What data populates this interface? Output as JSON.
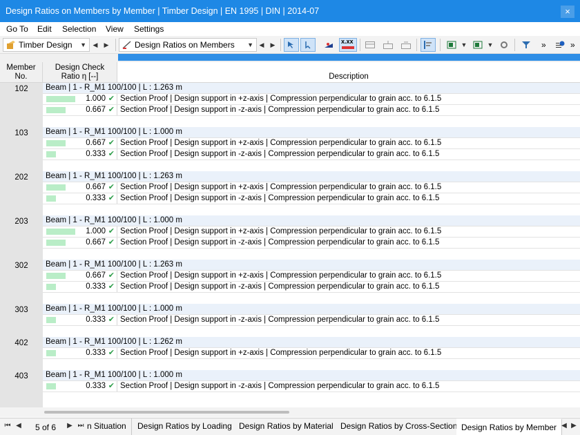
{
  "window": {
    "title": "Design Ratios on Members by Member | Timber Design | EN 1995 | DIN | 2014-07",
    "close_glyph": "×"
  },
  "menu": [
    "Go To",
    "Edit",
    "Selection",
    "View",
    "Settings"
  ],
  "toolbar": {
    "module": "Timber Design",
    "view": "Design Ratios on Members",
    "xxx_label": "x.xx",
    "overflow": "»"
  },
  "columns": {
    "member": [
      "Member",
      "No."
    ],
    "ratio": [
      "Design Check",
      "Ratio η [--]"
    ],
    "description": "Description"
  },
  "members": [
    {
      "no": "102",
      "beam": "Beam | 1 - R_M1 100/100 | L : 1.263 m",
      "checks": [
        {
          "ratio": 1.0,
          "ratio_text": "1.000",
          "desc": "Section Proof | Design support in +z-axis | Compression perpendicular to grain acc. to 6.1.5"
        },
        {
          "ratio": 0.667,
          "ratio_text": "0.667",
          "desc": "Section Proof | Design support in -z-axis | Compression perpendicular to grain acc. to 6.1.5"
        }
      ]
    },
    {
      "no": "103",
      "beam": "Beam | 1 - R_M1 100/100 | L : 1.000 m",
      "checks": [
        {
          "ratio": 0.667,
          "ratio_text": "0.667",
          "desc": "Section Proof | Design support in +z-axis | Compression perpendicular to grain acc. to 6.1.5"
        },
        {
          "ratio": 0.333,
          "ratio_text": "0.333",
          "desc": "Section Proof | Design support in -z-axis | Compression perpendicular to grain acc. to 6.1.5"
        }
      ]
    },
    {
      "no": "202",
      "beam": "Beam | 1 - R_M1 100/100 | L : 1.263 m",
      "checks": [
        {
          "ratio": 0.667,
          "ratio_text": "0.667",
          "desc": "Section Proof | Design support in +z-axis | Compression perpendicular to grain acc. to 6.1.5"
        },
        {
          "ratio": 0.333,
          "ratio_text": "0.333",
          "desc": "Section Proof | Design support in -z-axis | Compression perpendicular to grain acc. to 6.1.5"
        }
      ]
    },
    {
      "no": "203",
      "beam": "Beam | 1 - R_M1 100/100 | L : 1.000 m",
      "checks": [
        {
          "ratio": 1.0,
          "ratio_text": "1.000",
          "desc": "Section Proof | Design support in +z-axis | Compression perpendicular to grain acc. to 6.1.5"
        },
        {
          "ratio": 0.667,
          "ratio_text": "0.667",
          "desc": "Section Proof | Design support in -z-axis | Compression perpendicular to grain acc. to 6.1.5"
        }
      ]
    },
    {
      "no": "302",
      "beam": "Beam | 1 - R_M1 100/100 | L : 1.263 m",
      "checks": [
        {
          "ratio": 0.667,
          "ratio_text": "0.667",
          "desc": "Section Proof | Design support in +z-axis | Compression perpendicular to grain acc. to 6.1.5"
        },
        {
          "ratio": 0.333,
          "ratio_text": "0.333",
          "desc": "Section Proof | Design support in -z-axis | Compression perpendicular to grain acc. to 6.1.5"
        }
      ]
    },
    {
      "no": "303",
      "beam": "Beam | 1 - R_M1 100/100 | L : 1.000 m",
      "checks": [
        {
          "ratio": 0.333,
          "ratio_text": "0.333",
          "desc": "Section Proof | Design support in -z-axis | Compression perpendicular to grain acc. to 6.1.5"
        }
      ]
    },
    {
      "no": "402",
      "beam": "Beam | 1 - R_M1 100/100 | L : 1.262 m",
      "checks": [
        {
          "ratio": 0.333,
          "ratio_text": "0.333",
          "desc": "Section Proof | Design support in +z-axis | Compression perpendicular to grain acc. to 6.1.5"
        }
      ]
    },
    {
      "no": "403",
      "beam": "Beam | 1 - R_M1 100/100 | L : 1.000 m",
      "checks": [
        {
          "ratio": 0.333,
          "ratio_text": "0.333",
          "desc": "Section Proof | Design support in -z-axis | Compression perpendicular to grain acc. to 6.1.5"
        }
      ]
    }
  ],
  "pager": "5 of 6",
  "tabs": [
    "n Situation",
    "Design Ratios by Loading",
    "Design Ratios by Material",
    "Design Ratios by Cross-Section",
    "Design Ratios by Member"
  ],
  "active_tab": "Design Ratios by Member",
  "colors": {
    "accent": "#1e88e5",
    "ratio_bar": "#b9edc7",
    "check": "#2e9e4b"
  }
}
